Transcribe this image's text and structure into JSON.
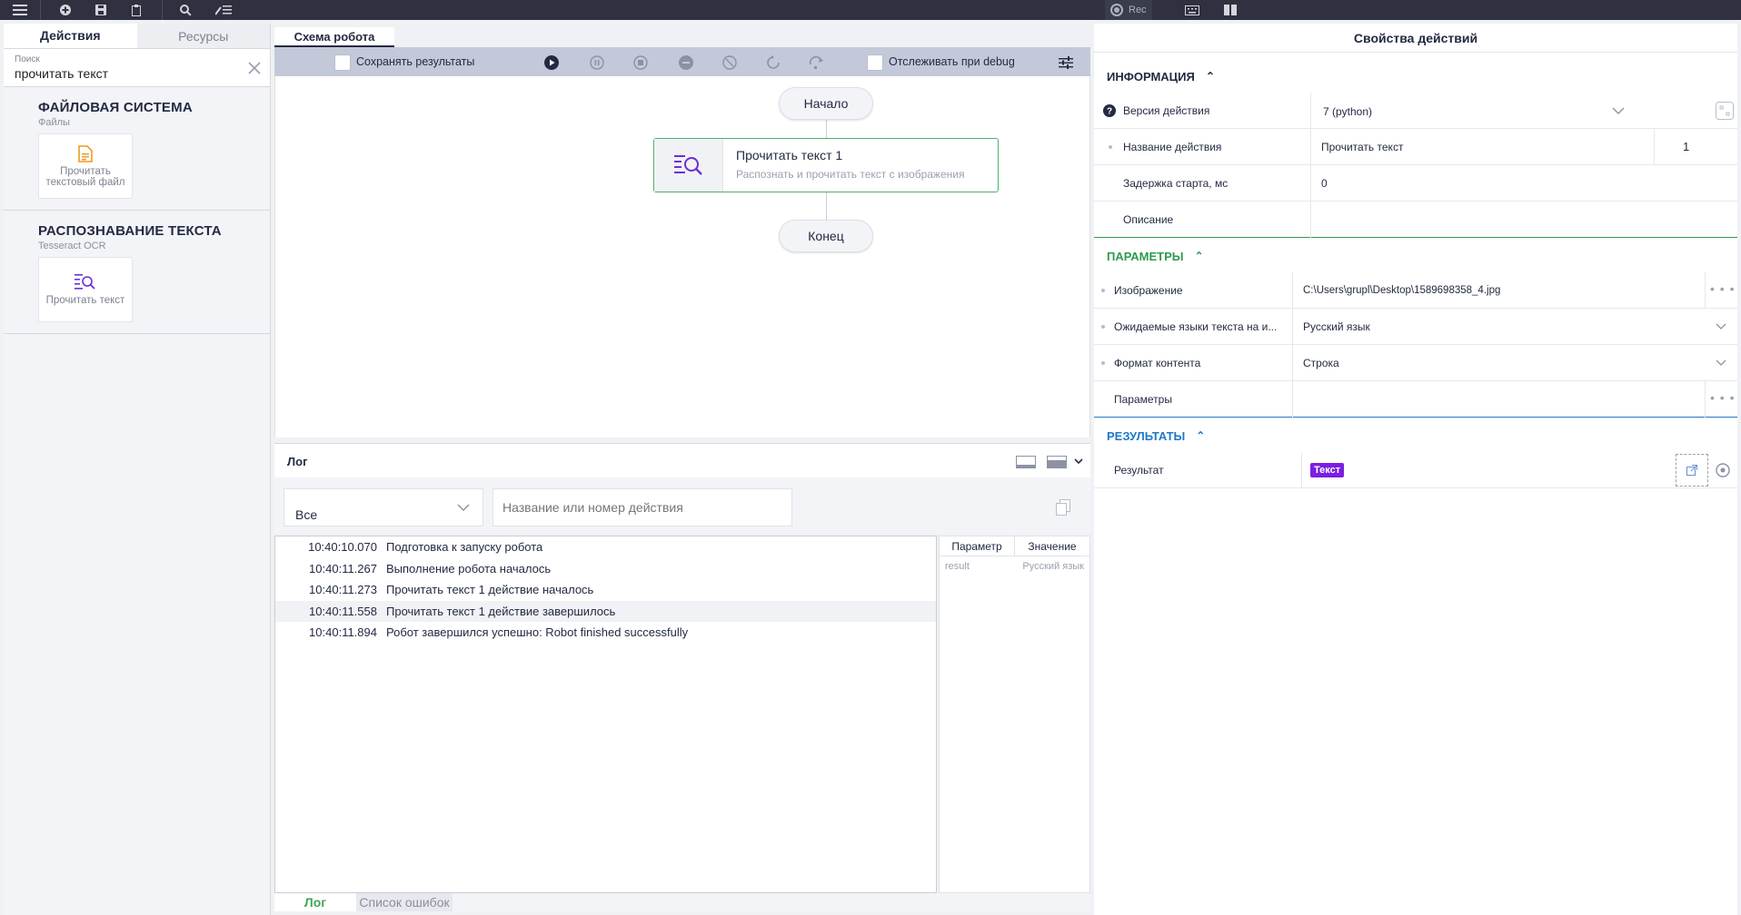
{
  "topbar": {
    "rec_label": "Rec"
  },
  "left_panel": {
    "tabs": [
      {
        "label": "Действия",
        "active": true
      },
      {
        "label": "Ресурсы",
        "active": false
      }
    ],
    "search": {
      "label": "Поиск",
      "value": "прочитать текст"
    },
    "groups": [
      {
        "title": "ФАЙЛОВАЯ СИСТЕМА",
        "subtitle": "Файлы",
        "items": [
          {
            "label": "Прочитать текстовый файл"
          }
        ]
      },
      {
        "title": "РАСПОЗНАВАНИЕ ТЕКСТА",
        "subtitle": "Tesseract OCR",
        "items": [
          {
            "label": "Прочитать текст"
          }
        ]
      }
    ]
  },
  "center": {
    "tab_label": "Схема робота",
    "toolbar": {
      "save_results_label": "Сохранять результаты",
      "track_debug_label": "Отслеживать при debug"
    },
    "flow": {
      "start_label": "Начало",
      "end_label": "Конец",
      "action": {
        "title": "Прочитать текст  1",
        "description": "Распознать и прочитать текст с изображения"
      }
    },
    "log": {
      "title": "Лог",
      "filter_value": "Все",
      "search_placeholder": "Название или номер действия",
      "entries": [
        {
          "time": "10:40:10.070",
          "message": "Подготовка к запуску робота"
        },
        {
          "time": "10:40:11.267",
          "message": "Выполнение робота началось"
        },
        {
          "time": "10:40:11.273",
          "message": "Прочитать текст 1 действие началось"
        },
        {
          "time": "10:40:11.558",
          "message": "Прочитать текст 1 действие завершилось"
        },
        {
          "time": "10:40:11.894",
          "message": "Робот завершился успешно: Robot finished successfully"
        }
      ],
      "params_headers": {
        "param": "Параметр",
        "value": "Значение"
      },
      "params_rows": [
        {
          "param": "result",
          "value": "Русский язык"
        }
      ]
    },
    "bottom_tabs": [
      {
        "label": "Лог",
        "active": true
      },
      {
        "label": "Список ошибок",
        "active": false
      }
    ]
  },
  "right_panel": {
    "title": "Свойства действий",
    "info": {
      "heading": "ИНФОРМАЦИЯ",
      "version_label": "Версия действия",
      "version_value": "7 (python)",
      "name_label": "Название действия",
      "name_value": "Прочитать текст",
      "name_number": "1",
      "delay_label": "Задержка старта, мс",
      "delay_value": "0",
      "description_label": "Описание",
      "description_value": ""
    },
    "params": {
      "heading": "ПАРАМЕТРЫ",
      "image_label": "Изображение",
      "image_value": "C:\\Users\\grupl\\Desktop\\1589698358_4.jpg",
      "langs_label": "Ожидаемые языки текста на и...",
      "langs_value": "Русский язык",
      "format_label": "Формат контента",
      "format_value": "Строка",
      "params_label": "Параметры",
      "params_value": ""
    },
    "results": {
      "heading": "РЕЗУЛЬТАТЫ",
      "result_label": "Результат",
      "result_badge": "Текст"
    }
  },
  "colors": {
    "topbar": "#2f3140",
    "info_heading": "#232a42",
    "params_heading": "#2f9a4f",
    "results_heading": "#1f78c8",
    "badge": "#7b1fe0"
  }
}
